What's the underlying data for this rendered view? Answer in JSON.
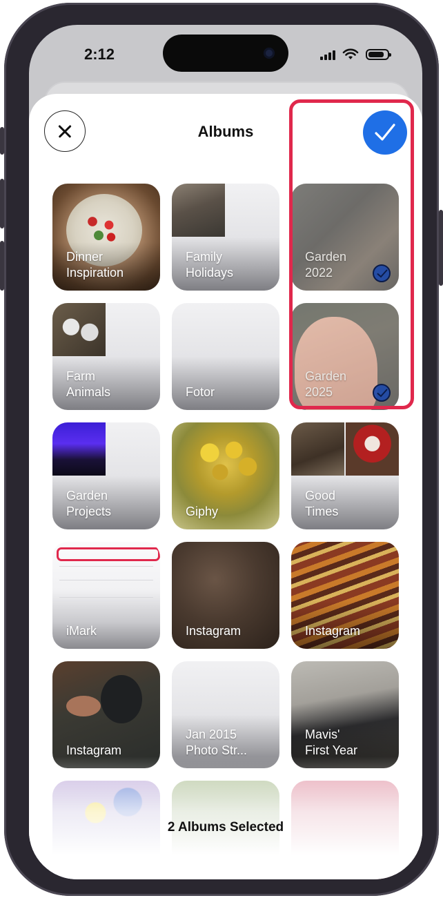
{
  "status_bar": {
    "time": "2:12",
    "icons": [
      "signal-bars-icon",
      "wifi-icon",
      "battery-icon"
    ]
  },
  "sheet": {
    "title": "Albums",
    "close_icon": "close-icon",
    "done_icon": "checkmark-icon",
    "selected_summary": "2 Albums Selected"
  },
  "albums": [
    {
      "label": "Dinner\nInspiration",
      "selected": false
    },
    {
      "label": "Family\nHolidays",
      "selected": false
    },
    {
      "label": "Garden\n2022",
      "selected": true
    },
    {
      "label": "Farm\nAnimals",
      "selected": false
    },
    {
      "label": "Fotor",
      "selected": false
    },
    {
      "label": "Garden\n2025",
      "selected": true
    },
    {
      "label": "Garden\nProjects",
      "selected": false
    },
    {
      "label": "Giphy",
      "selected": false
    },
    {
      "label": "Good\nTimes",
      "selected": false
    },
    {
      "label": "iMark",
      "selected": false
    },
    {
      "label": "Instagram",
      "selected": false
    },
    {
      "label": "Instagram",
      "selected": false
    },
    {
      "label": "Instagram",
      "selected": false
    },
    {
      "label": "Jan 2015\nPhoto Str...",
      "selected": false
    },
    {
      "label": "Mavis'\nFirst Year",
      "selected": false
    }
  ],
  "colors": {
    "accent": "#1f6fe6",
    "highlight": "#e0284c"
  }
}
